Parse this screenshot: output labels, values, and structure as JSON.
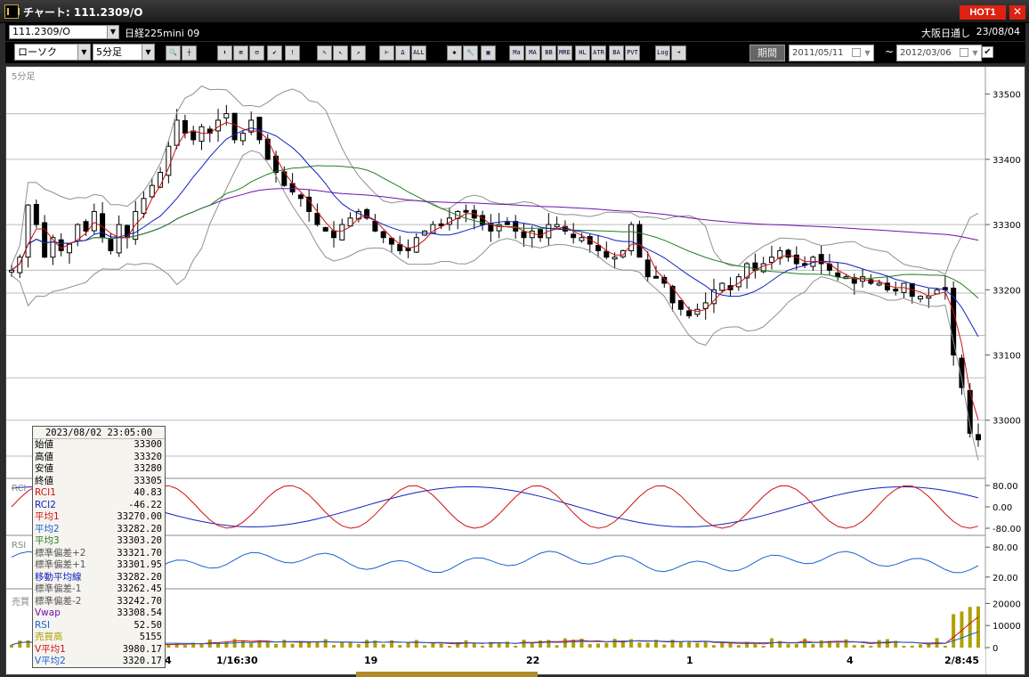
{
  "window": {
    "title": "チャート: 111.2309/O",
    "hot_label": "HOT1",
    "close_label": "✕"
  },
  "header": {
    "symbol": "111.2309/O",
    "contract_name": "日経225mini 09",
    "session": "大阪日通し",
    "date": "23/08/04"
  },
  "toolbar": {
    "chart_type": "ローソク",
    "interval": "5分足",
    "icons": [
      "zoom-icon",
      "crosshair-icon",
      "download-icon",
      "compare-icon",
      "window-icon",
      "flag-icon",
      "alert-icon",
      "pen-icon",
      "cursor-icon",
      "line-icon",
      "bar-icon",
      "delta-icon",
      "all-icon",
      "settings-icon",
      "wrench-icon",
      "palette-icon",
      "ma-icon",
      "ma-icon",
      "bb-icon",
      "mre-icon",
      "hl-icon",
      "atr-icon",
      "ba-icon",
      "pvt-icon",
      "log-icon",
      "export-icon"
    ],
    "icon_labels": [
      "🔍",
      "┼",
      "⬇",
      "⊞",
      "⊟",
      "✔",
      "!",
      "✎",
      "↖",
      "↗",
      "⊢",
      "Δ",
      "ALL",
      "✱",
      "🔧",
      "▦",
      "Ma",
      "MA",
      "BB",
      "MRE",
      "HL",
      "ATR",
      "BA",
      "PVT",
      "Log",
      "➜"
    ],
    "period_button": "期間",
    "date_from": "2011/05/11",
    "date_to": "2012/03/06",
    "separator": "~",
    "check_mark": "✔"
  },
  "chart": {
    "interval_label": "5分足",
    "price_ticks": [
      "33500",
      "33400",
      "33300",
      "33200",
      "33100",
      "33000"
    ],
    "rci_ticks": [
      "80.00",
      "0.00",
      "-80.00"
    ],
    "rsi_ticks": [
      "80.00",
      "20.00"
    ],
    "vol_ticks": [
      "20000",
      "10000",
      "0"
    ],
    "x_labels": [
      "4",
      "1/16:30",
      "19",
      "22",
      "1",
      "4",
      "2/8:45"
    ],
    "panel_labels": [
      "RCI",
      "RSI",
      "売買"
    ],
    "colors": {
      "ma1": "#d01010",
      "ma2": "#1020c0",
      "ma3": "#208020",
      "bb": "#909090",
      "vwap": "#7010b0",
      "rsi": "#1a60d0",
      "volume": "#b0a000"
    }
  },
  "chart_data": {
    "type": "candlestick",
    "price_range": [
      32930,
      33520
    ],
    "closes": [
      33230,
      33250,
      33330,
      33300,
      33250,
      33280,
      33260,
      33270,
      33300,
      33290,
      33320,
      33280,
      33260,
      33300,
      33280,
      33320,
      33340,
      33360,
      33380,
      33420,
      33460,
      33440,
      33430,
      33450,
      33440,
      33460,
      33470,
      33430,
      33440,
      33460,
      33430,
      33400,
      33380,
      33360,
      33350,
      33340,
      33320,
      33300,
      33290,
      33280,
      33300,
      33310,
      33320,
      33310,
      33290,
      33280,
      33270,
      33260,
      33260,
      33280,
      33290,
      33300,
      33300,
      33310,
      33320,
      33320,
      33310,
      33300,
      33290,
      33300,
      33300,
      33290,
      33280,
      33290,
      33280,
      33300,
      33300,
      33290,
      33280,
      33280,
      33270,
      33260,
      33250,
      33250,
      33260,
      33300,
      33250,
      33220,
      33220,
      33210,
      33180,
      33170,
      33160,
      33170,
      33180,
      33200,
      33210,
      33200,
      33220,
      33240,
      33230,
      33240,
      33250,
      33260,
      33250,
      33240,
      33240,
      33250,
      33240,
      33230,
      33220,
      33220,
      33210,
      33220,
      33210,
      33210,
      33200,
      33200,
      33210,
      33190,
      33190,
      33190,
      33200,
      33200,
      33100,
      33050,
      32980,
      32970
    ],
    "rci1_range": [
      -100,
      100
    ],
    "rci2_range": [
      -100,
      100
    ],
    "rsi_range": [
      0,
      100
    ],
    "volume_range": [
      0,
      25000
    ],
    "info": {
      "timestamp": "2023/08/02 23:05:00",
      "rows": [
        {
          "label": "始値",
          "value": "33300",
          "color": "#000"
        },
        {
          "label": "高値",
          "value": "33320",
          "color": "#000"
        },
        {
          "label": "安値",
          "value": "33280",
          "color": "#000"
        },
        {
          "label": "終値",
          "value": "33305",
          "color": "#000"
        },
        {
          "label": "RCI1",
          "value": "40.83",
          "color": "#d01010"
        },
        {
          "label": "RCI2",
          "value": "-46.22",
          "color": "#1020c0"
        },
        {
          "label": "平均1",
          "value": "33270.00",
          "color": "#d01010"
        },
        {
          "label": "平均2",
          "value": "33282.20",
          "color": "#1a60d0"
        },
        {
          "label": "平均3",
          "value": "33303.20",
          "color": "#208020"
        },
        {
          "label": "標準偏差+2",
          "value": "33321.70",
          "color": "#555"
        },
        {
          "label": "標準偏差+1",
          "value": "33301.95",
          "color": "#555"
        },
        {
          "label": "移動平均線",
          "value": "33282.20",
          "color": "#1020c0"
        },
        {
          "label": "標準偏差-1",
          "value": "33262.45",
          "color": "#555"
        },
        {
          "label": "標準偏差-2",
          "value": "33242.70",
          "color": "#555"
        },
        {
          "label": "Vwap",
          "value": "33308.54",
          "color": "#7010b0"
        },
        {
          "label": "RSI",
          "value": "52.50",
          "color": "#1a60d0"
        },
        {
          "label": "売買高",
          "value": "5155",
          "color": "#b0a000"
        },
        {
          "label": "V平均1",
          "value": "3980.17",
          "color": "#d01010"
        },
        {
          "label": "V平均2",
          "value": "3320.17",
          "color": "#1a60d0"
        }
      ]
    }
  }
}
